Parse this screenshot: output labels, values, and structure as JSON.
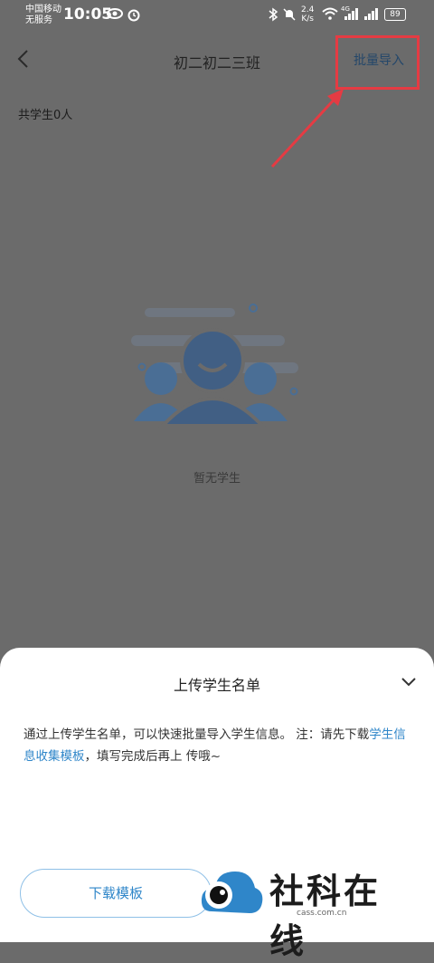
{
  "status_bar": {
    "carrier_line1": "中国移动",
    "carrier_line2": "无服务",
    "time": "10:05",
    "eye_icon": "eye-icon",
    "alarm_icon": "alarm-icon",
    "speed_value": "2.4",
    "speed_unit": "K/s",
    "network": "4G",
    "battery": "89"
  },
  "nav": {
    "title": "初二初二三班",
    "import_label": "批量导入"
  },
  "student_count": "共学生0人",
  "empty_state": {
    "text": "暂无学生"
  },
  "sheet": {
    "title": "上传学生名单",
    "desc_part1": "通过上传学生名单，可以快速批量导入学生信息。 注：请先下载",
    "desc_link": "学生信息收集模板",
    "desc_part2": "，填写完成后再上 传哦~",
    "download_label": "下载模板"
  },
  "watermark": {
    "name": "社科在线",
    "domain": "cass.com.cn"
  },
  "colors": {
    "accent": "#2f86c9",
    "annotation": "#e53b43",
    "overlay": "#6b6b6b"
  }
}
